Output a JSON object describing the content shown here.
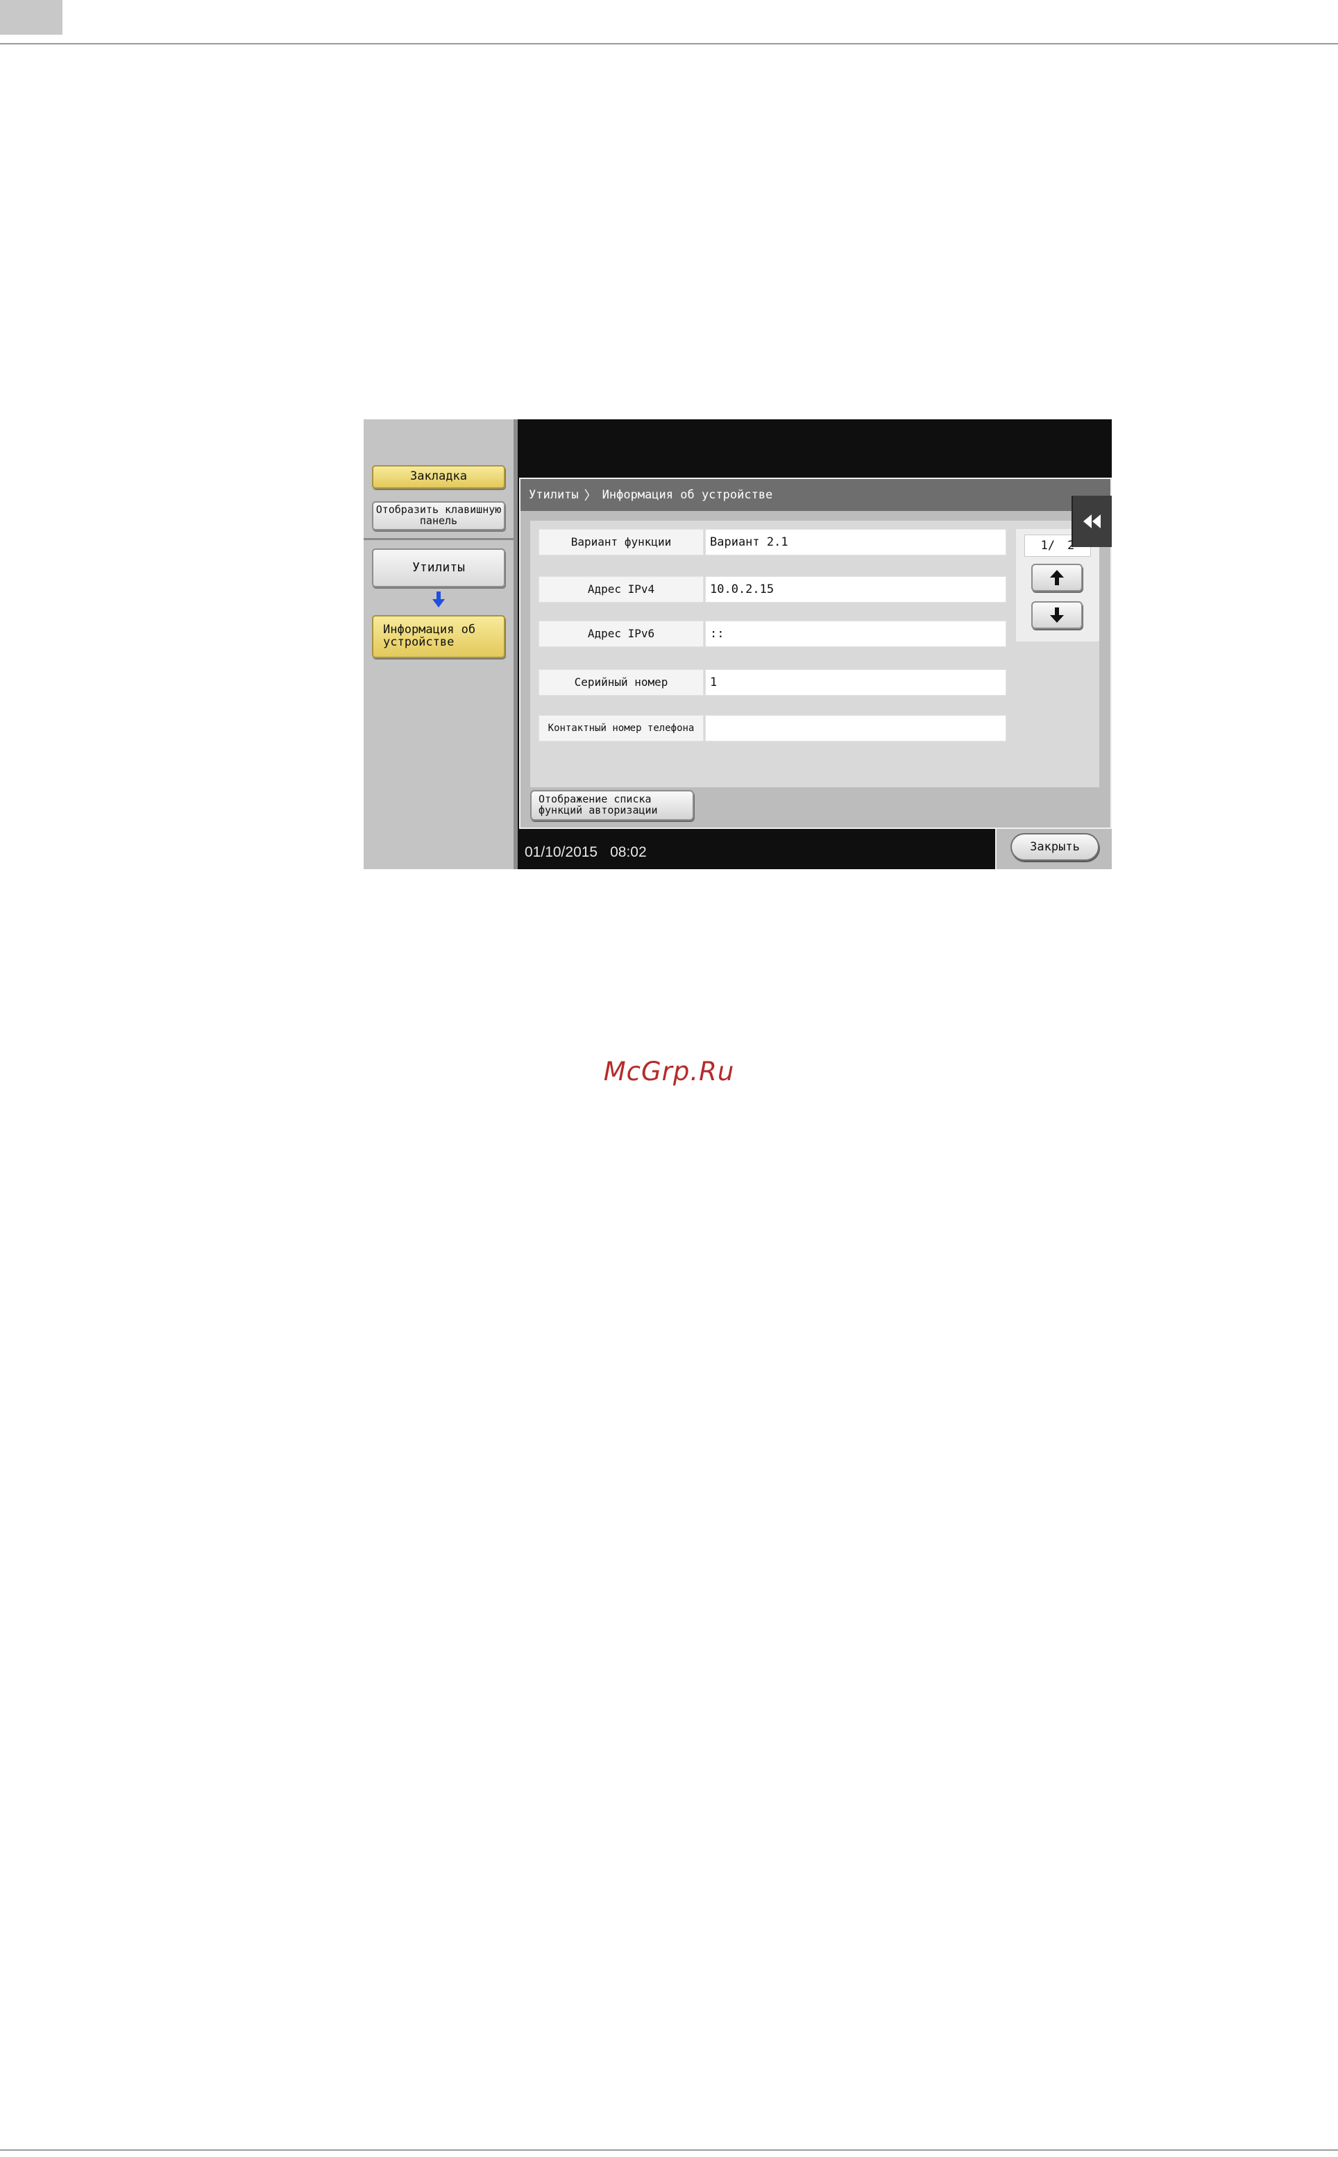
{
  "sidebar": {
    "bookmark_label": "Закладка",
    "show_keyboard_label": "Отобразить клавишную панель",
    "utilities_label": "Утилиты",
    "device_info_label": "Информация об устройстве"
  },
  "breadcrumb": {
    "root": "Утилиты",
    "current": "Информация об устройстве"
  },
  "device_info": {
    "rows": [
      {
        "label": "Вариант функции",
        "value": "Вариант 2.1"
      },
      {
        "label": "Адрес IPv4",
        "value": "10.0.2.15"
      },
      {
        "label": "Адрес IPv6",
        "value": "::"
      },
      {
        "label": "Серийный номер",
        "value": "1"
      },
      {
        "label": "Контактный номер телефона",
        "value": ""
      }
    ]
  },
  "pager": {
    "current": "1/",
    "total": "2"
  },
  "auth_list_button_label": "Отображение списка функций авторизации",
  "status_bar": {
    "date": "01/10/2015",
    "time": "08:02"
  },
  "close_label": "Закрыть",
  "watermark": "McGrp.Ru",
  "icons": {
    "flow_arrow": "arrow-down-icon",
    "page_up": "arrow-up-icon",
    "page_down": "arrow-down-icon",
    "collapse": "double-chevron-left-icon"
  },
  "colors": {
    "highlight_button": "#e9d36f",
    "dark_background": "#0f0f10",
    "title_bar": "#6e6e6e",
    "watermark": "#b52b2b",
    "flow_arrow": "#1f4fe0"
  }
}
